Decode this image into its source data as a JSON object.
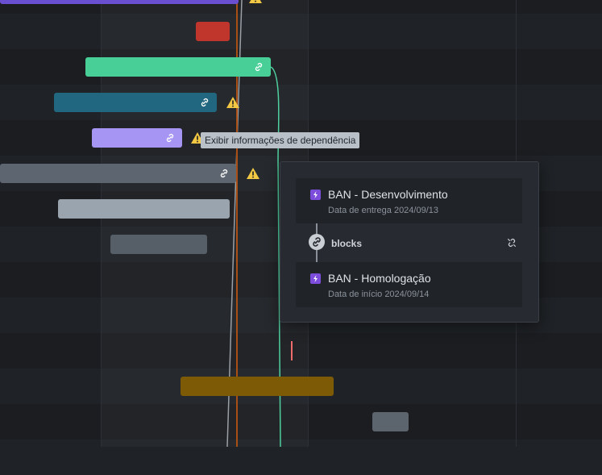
{
  "colors": {
    "background": "#1b1d21",
    "today_line": "#a84f16",
    "dependency_line_green": "#4fd1a0",
    "dependency_line_gray": "#9aa0a6",
    "warning": "#f2c744",
    "bar_purple_top": "#6a4fd1",
    "bar_red": "#c0362c",
    "bar_green": "#47cf97",
    "bar_teal": "#21677f",
    "bar_lavender": "#a695f2",
    "bar_slate": "#5d6670",
    "bar_light_slate": "#9aa4ae",
    "bar_dark_slate": "#565f68",
    "bar_mustard": "#7c5a06",
    "bar_small_gray": "#5c646d",
    "marker_red": "#f16b6b"
  },
  "icons": {
    "link": "link-icon",
    "warning": "warning-icon",
    "issue_type": "epic-icon",
    "unlink": "unlink-icon"
  },
  "tooltip": {
    "text": "Exibir informações de dependência"
  },
  "dependency_popover": {
    "source": {
      "title": "BAN - Desenvolvimento",
      "date_label": "Data de entrega 2024/09/13"
    },
    "relation": "blocks",
    "target": {
      "title": "BAN - Homologação",
      "date_label": "Data de início 2024/09/14"
    }
  }
}
